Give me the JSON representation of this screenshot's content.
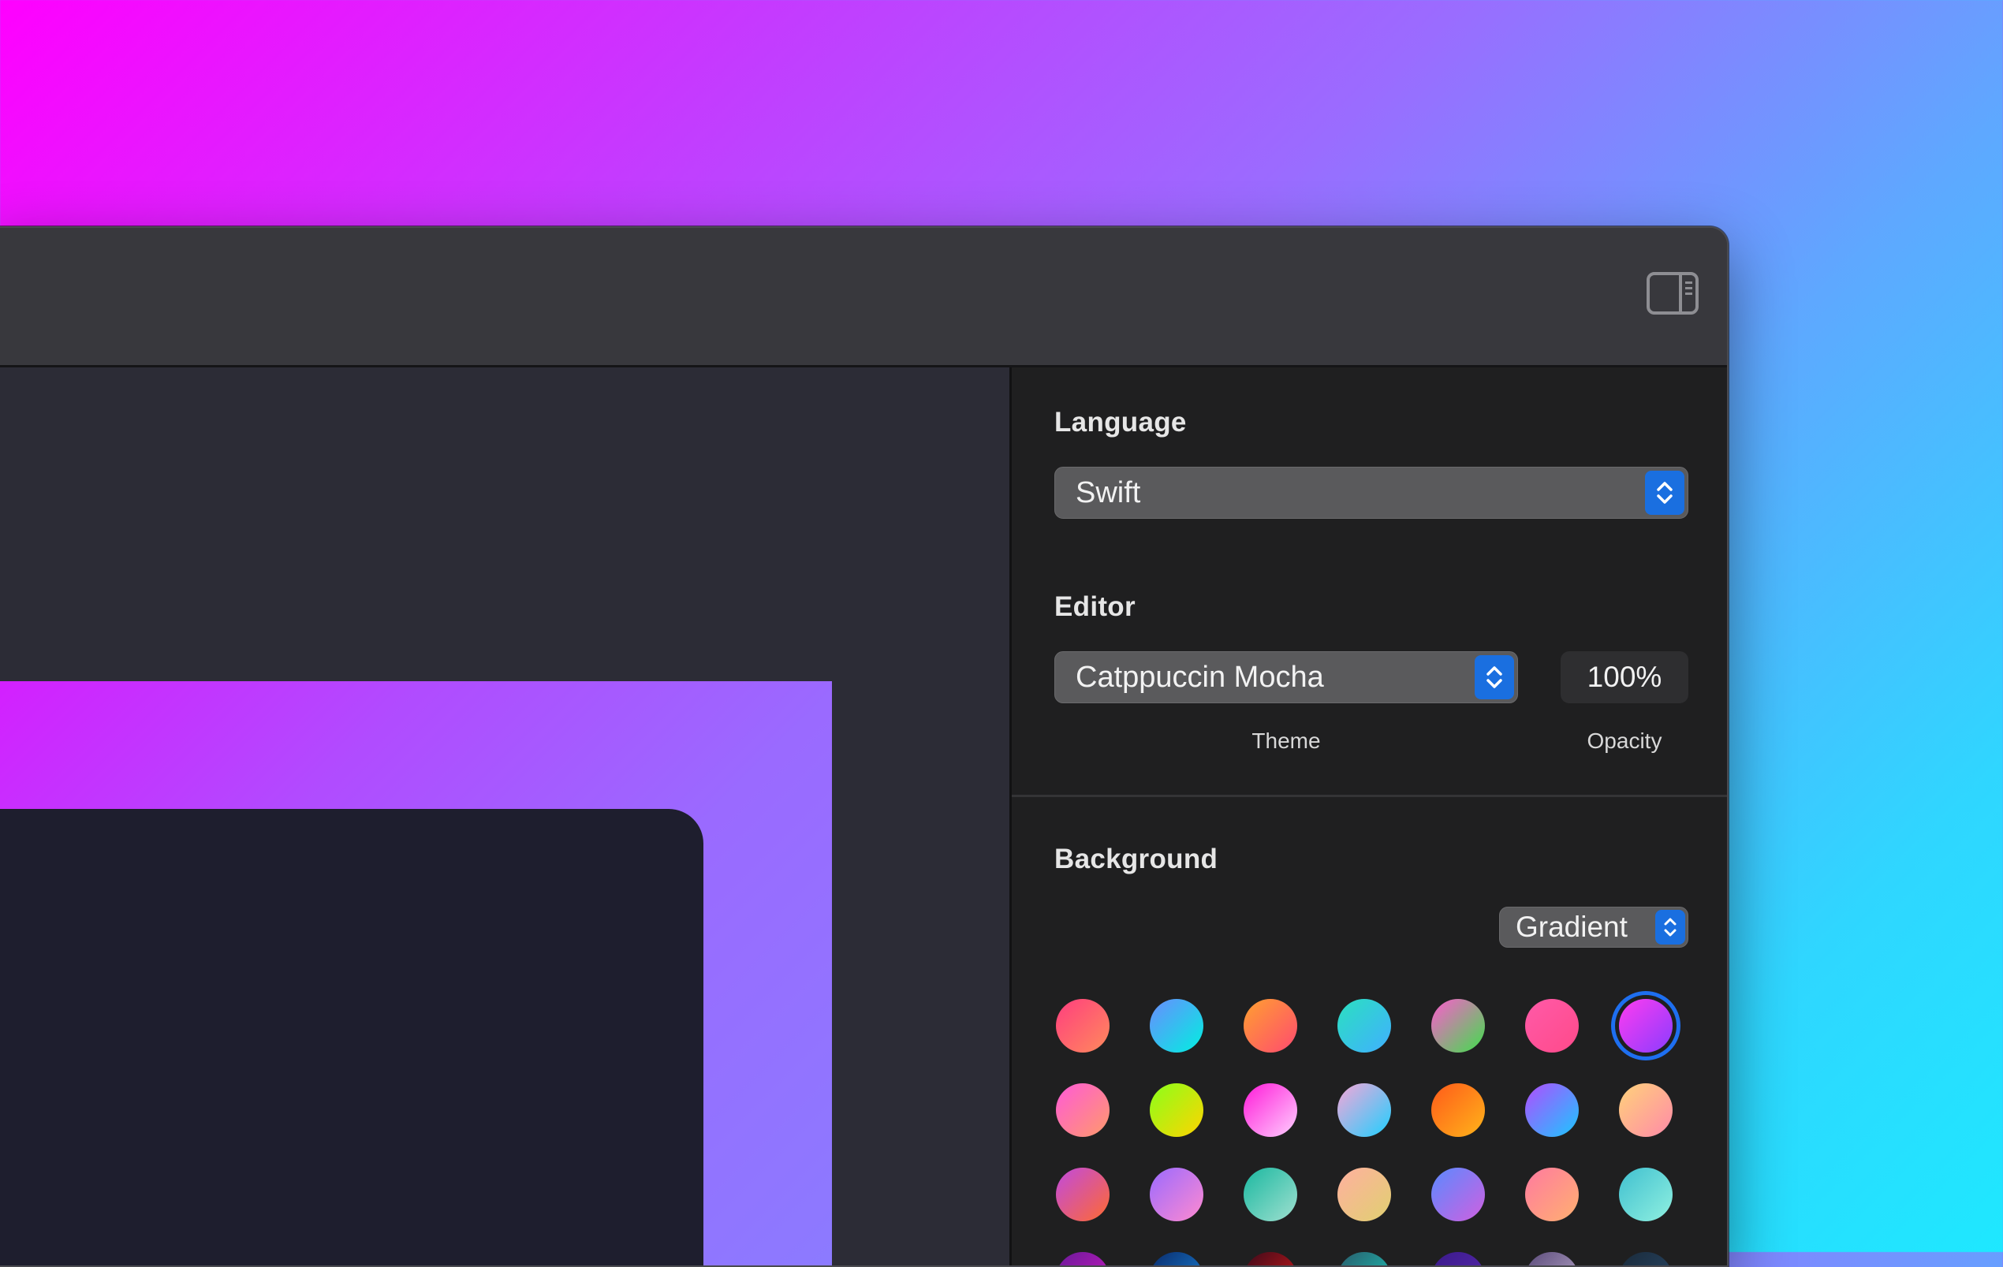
{
  "inspector": {
    "language": {
      "title": "Language",
      "selected": "Swift"
    },
    "editor": {
      "title": "Editor",
      "theme": "Catppuccin Mocha",
      "theme_caption": "Theme",
      "opacity": "100%",
      "opacity_caption": "Opacity"
    },
    "background": {
      "title": "Background",
      "mode": "Gradient",
      "selected_swatch": 6,
      "swatches": [
        [
          "#ff3e7f",
          "#ff8a5c"
        ],
        [
          "#6a8cff",
          "#00f0e0"
        ],
        [
          "#ffa030",
          "#ff4a70"
        ],
        [
          "#2be0c0",
          "#40b0ff"
        ],
        [
          "#ff5ad0",
          "#3ee04a"
        ],
        [
          "#ff5aa8",
          "#ff4a8a"
        ],
        [
          "#ff3cf0",
          "#8a3cff"
        ],
        [
          "#ff5ad8",
          "#ff9a6a"
        ],
        [
          "#8aff1a",
          "#ffd400"
        ],
        [
          "#ff1ad8",
          "#ffd0ff"
        ],
        [
          "#f7a6d8",
          "#1ed0ff"
        ],
        [
          "#ff5a1a",
          "#ffb41a"
        ],
        [
          "#b24cff",
          "#1ac8ff"
        ],
        [
          "#ffd27a",
          "#ff8aa8"
        ],
        [
          "#c04ae0",
          "#ff6a30"
        ],
        [
          "#9a6aff",
          "#ff8ad0"
        ],
        [
          "#1ab8a0",
          "#a0e0d0"
        ],
        [
          "#ffb0a0",
          "#e0d070"
        ],
        [
          "#5a8aff",
          "#d060e0"
        ],
        [
          "#ff7aa0",
          "#ffb070"
        ],
        [
          "#40c0d0",
          "#90f0e0"
        ],
        [
          "#6a1a9a",
          "#d01ac0"
        ],
        [
          "#0a2a6a",
          "#1a8ae0"
        ],
        [
          "#3a0a1a",
          "#e01a1a"
        ],
        [
          "#2a5a6a",
          "#1ad0c0"
        ],
        [
          "#3a1a8a",
          "#5a2ab0"
        ],
        [
          "#5a4a7a",
          "#c0b0d0"
        ],
        [
          "#1a2a3a",
          "#2a4a6a"
        ]
      ]
    }
  }
}
